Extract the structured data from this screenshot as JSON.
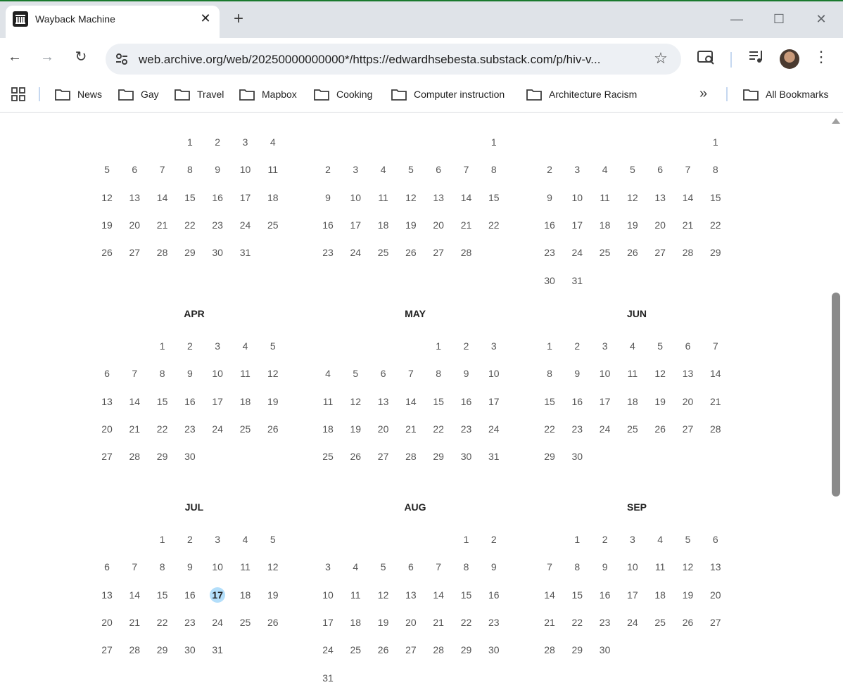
{
  "tab": {
    "title": "Wayback Machine",
    "close_label": "✕",
    "new_label": "+"
  },
  "window_controls": {
    "minimize": "—",
    "maximize": "☐",
    "close": "✕"
  },
  "toolbar": {
    "url": "web.archive.org/web/20250000000000*/https://edwardhsebesta.substack.com/p/hiv-v...",
    "back": "←",
    "forward": "→",
    "reload": "↻",
    "star": "☆",
    "menu": "⋮"
  },
  "bookmarks": [
    {
      "label": "News"
    },
    {
      "label": "Gay"
    },
    {
      "label": "Travel"
    },
    {
      "label": "Mapbox"
    },
    {
      "label": "Cooking"
    },
    {
      "label": "Computer instruction"
    },
    {
      "label": "Architecture Racism"
    }
  ],
  "bookmarks_more": "»",
  "all_bookmarks": "All Bookmarks",
  "calendar": {
    "highlight_color": "#b3defa",
    "rows": [
      [
        {
          "name": "",
          "start": 3,
          "days": 31
        },
        {
          "name": "",
          "start": 6,
          "days": 28
        },
        {
          "name": "",
          "start": 6,
          "days": 31
        }
      ],
      [
        {
          "name": "APR",
          "start": 2,
          "days": 30
        },
        {
          "name": "MAY",
          "start": 4,
          "days": 31
        },
        {
          "name": "JUN",
          "start": 0,
          "days": 30
        }
      ],
      [
        {
          "name": "JUL",
          "start": 2,
          "days": 31,
          "highlight": 17
        },
        {
          "name": "AUG",
          "start": 5,
          "days": 31
        },
        {
          "name": "SEP",
          "start": 1,
          "days": 30
        }
      ]
    ]
  }
}
